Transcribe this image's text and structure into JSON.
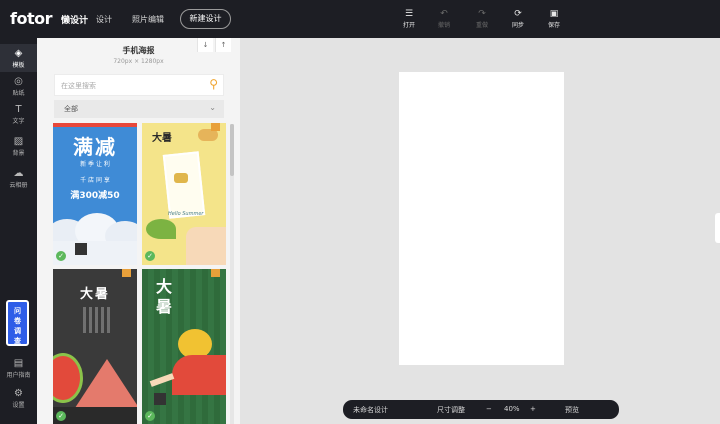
{
  "topbar": {
    "logo": "fotor",
    "logo_sub": "懒设计",
    "nav": [
      "设计",
      "照片编辑"
    ],
    "new_design": "新建设计",
    "tools": [
      {
        "label": "打开",
        "icon": "hamburger-icon",
        "enabled": true
      },
      {
        "label": "撤销",
        "icon": "undo-icon",
        "enabled": false
      },
      {
        "label": "重做",
        "icon": "redo-icon",
        "enabled": false
      },
      {
        "label": "同步",
        "icon": "sync-icon",
        "enabled": true
      },
      {
        "label": "保存",
        "icon": "save-icon",
        "enabled": true
      }
    ]
  },
  "rail": {
    "items": [
      {
        "label": "模板",
        "icon": "layers-icon",
        "active": true
      },
      {
        "label": "贴纸",
        "icon": "sticker-icon",
        "active": false
      },
      {
        "label": "文字",
        "icon": "text-icon",
        "active": false
      },
      {
        "label": "背景",
        "icon": "background-icon",
        "active": false
      },
      {
        "label": "云相册",
        "icon": "cloud-upload-icon",
        "active": false
      },
      {
        "label": "用户指南",
        "icon": "guide-icon",
        "active": false
      },
      {
        "label": "设置",
        "icon": "gear-icon",
        "active": false
      }
    ],
    "survey": "问卷调查"
  },
  "panel": {
    "title": "手机海报",
    "size": "720px × 1280px",
    "search_placeholder": "在这里搜索",
    "category": "全部",
    "templates": [
      {
        "headline": "满减",
        "line1": "新 季 让 利",
        "line2": "千 店 同 享",
        "offer": "满300减50",
        "bg": "#3f8bd6"
      },
      {
        "headline": "大暑",
        "script": "Hello Summer",
        "bg": "#f4e48a"
      },
      {
        "headline": "大暑",
        "bg": "#3a3a3a"
      },
      {
        "headline": "大暑",
        "bg": "#2f6b3b"
      }
    ]
  },
  "bottombar": {
    "doc_name": "未命名设计",
    "resize": "尺寸调整",
    "minus": "−",
    "zoom": "40%",
    "plus": "+",
    "preview": "预览"
  }
}
